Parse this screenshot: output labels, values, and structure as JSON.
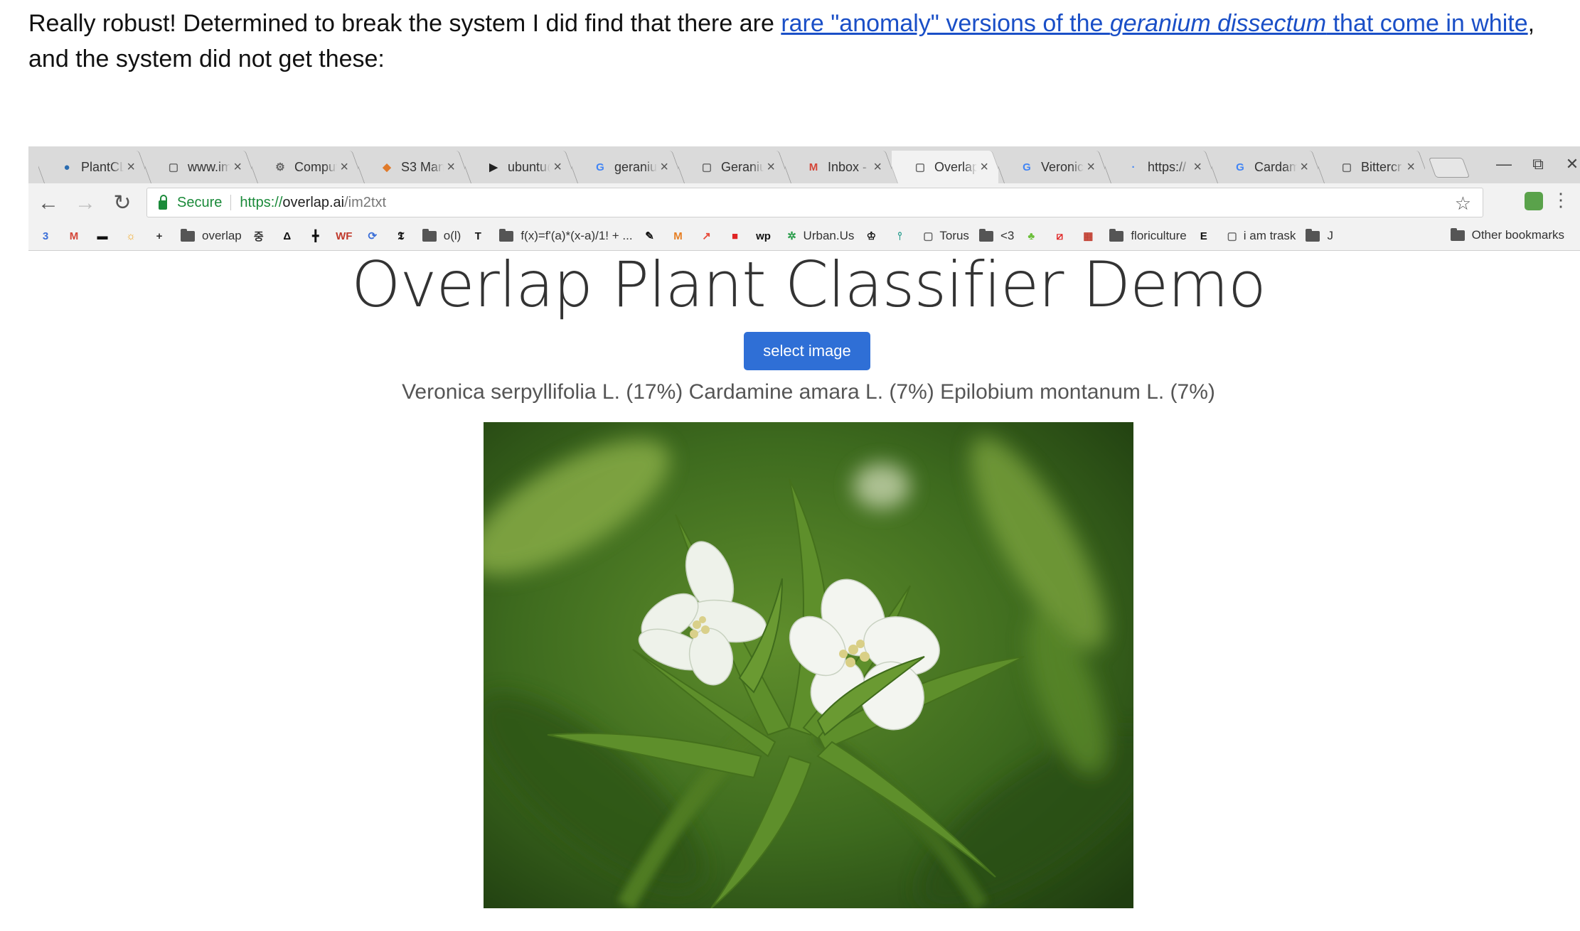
{
  "blog": {
    "before_link": "Really robust!  Determined to break the system I did find that there are ",
    "link_part1": "rare \"anomaly\" versions of the ",
    "link_italic": "geranium dissectum",
    "link_part2": " that come in white",
    "after_link": ", and the system did not get these:"
  },
  "tabs": [
    {
      "title": "PlantCL",
      "icon": "drupal-icon",
      "color": "#2b6cb0"
    },
    {
      "title": "www.im",
      "icon": "page-icon",
      "color": "#666"
    },
    {
      "title": "Comput",
      "icon": "chip-icon",
      "color": "#666"
    },
    {
      "title": "S3 Man",
      "icon": "aws-s3-icon",
      "color": "#e07a2a"
    },
    {
      "title": "ubuntu@",
      "icon": "terminal-icon",
      "color": "#222"
    },
    {
      "title": "geranium",
      "icon": "google-icon",
      "color": "#4285f4"
    },
    {
      "title": "Geranium",
      "icon": "page-icon",
      "color": "#666"
    },
    {
      "title": "Inbox - l",
      "icon": "gmail-icon",
      "color": "#d44638"
    },
    {
      "title": "Overlap",
      "icon": "page-icon",
      "color": "#666",
      "active": true
    },
    {
      "title": "Veronica",
      "icon": "google-icon",
      "color": "#4285f4"
    },
    {
      "title": "https://",
      "icon": "loading-icon",
      "color": "#4285f4"
    },
    {
      "title": "Cardam",
      "icon": "google-icon",
      "color": "#4285f4"
    },
    {
      "title": "Bittercr",
      "icon": "page-icon",
      "color": "#666"
    }
  ],
  "omnibox": {
    "secure_label": "Secure",
    "scheme": "https://",
    "host": "overlap.ai",
    "path": "/im2txt"
  },
  "bookmarks": [
    {
      "label": "",
      "icon": "calendar-icon",
      "glyph": "3",
      "color": "#3b6fd8"
    },
    {
      "label": "",
      "icon": "gmail-icon",
      "glyph": "M",
      "color": "#d44638"
    },
    {
      "label": "",
      "icon": "dash-icon",
      "glyph": "▬",
      "color": "#111"
    },
    {
      "label": "",
      "icon": "sun-icon",
      "glyph": "☼",
      "color": "#f2a51a"
    },
    {
      "label": "",
      "icon": "plus-icon",
      "glyph": "+",
      "color": "#333"
    },
    {
      "label": "overlap",
      "icon": "folder-icon",
      "folder": true
    },
    {
      "label": "",
      "icon": "zh-icon",
      "glyph": "중",
      "color": "#333"
    },
    {
      "label": "",
      "icon": "delta-icon",
      "glyph": "Δ",
      "color": "#111"
    },
    {
      "label": "",
      "icon": "grid-icon",
      "glyph": "╋",
      "color": "#111"
    },
    {
      "label": "",
      "icon": "wf-icon",
      "glyph": "WF",
      "color": "#c0392b"
    },
    {
      "label": "",
      "icon": "sync-icon",
      "glyph": "⟳",
      "color": "#3b6fd8"
    },
    {
      "label": "",
      "icon": "nyt-icon",
      "glyph": "𝕿",
      "color": "#111"
    },
    {
      "label": "o(l)",
      "icon": "folder-icon",
      "folder": true
    },
    {
      "label": "",
      "icon": "t-icon",
      "glyph": "T",
      "color": "#111"
    },
    {
      "label": "f(x)=f'(a)*(x-a)/1! + ...",
      "icon": "folder-icon",
      "folder": true
    },
    {
      "label": "",
      "icon": "pin-icon",
      "glyph": "✎",
      "color": "#111"
    },
    {
      "label": "",
      "icon": "m-icon",
      "glyph": "M",
      "color": "#e67e22"
    },
    {
      "label": "",
      "icon": "chart-icon",
      "glyph": "↗",
      "color": "#e74c3c"
    },
    {
      "label": "",
      "icon": "red-square-icon",
      "glyph": "■",
      "color": "#e02424"
    },
    {
      "label": "",
      "icon": "wp-icon",
      "glyph": "wp",
      "color": "#111"
    },
    {
      "label": "Urban.Us",
      "icon": "urbanus-icon",
      "glyph": "✲",
      "color": "#2a9d4b"
    },
    {
      "label": "",
      "icon": "crown-icon",
      "glyph": "♔",
      "color": "#111"
    },
    {
      "label": "",
      "icon": "plant-icon",
      "glyph": "⫯",
      "color": "#2a9d8f"
    },
    {
      "label": "Torus",
      "icon": "page-icon",
      "glyph": "▢",
      "color": "#666"
    },
    {
      "label": "<3",
      "icon": "folder-icon",
      "folder": true
    },
    {
      "label": "",
      "icon": "sprout-icon",
      "glyph": "♣",
      "color": "#6bbf3a"
    },
    {
      "label": "",
      "icon": "slash-icon",
      "glyph": "⧄",
      "color": "#e02424"
    },
    {
      "label": "",
      "icon": "tag-icon",
      "glyph": "▦",
      "color": "#c0392b"
    },
    {
      "label": "floriculture",
      "icon": "folder-icon",
      "folder": true
    },
    {
      "label": "",
      "icon": "e-icon",
      "glyph": "E",
      "color": "#111"
    },
    {
      "label": "i am trask",
      "icon": "page-icon",
      "glyph": "▢",
      "color": "#666"
    },
    {
      "label": "J",
      "icon": "folder-icon",
      "folder": true
    }
  ],
  "other_bookmarks": "Other bookmarks",
  "page": {
    "title": "Overlap Plant Classifier Demo",
    "button_label": "select image",
    "result": "Veronica serpyllifolia L. (17%) Cardamine amara L. (7%) Epilobium montanum L. (7%)"
  },
  "colors": {
    "button": "#2f6fd6",
    "link": "#1a4fc7",
    "secure": "#1b8a3a"
  }
}
